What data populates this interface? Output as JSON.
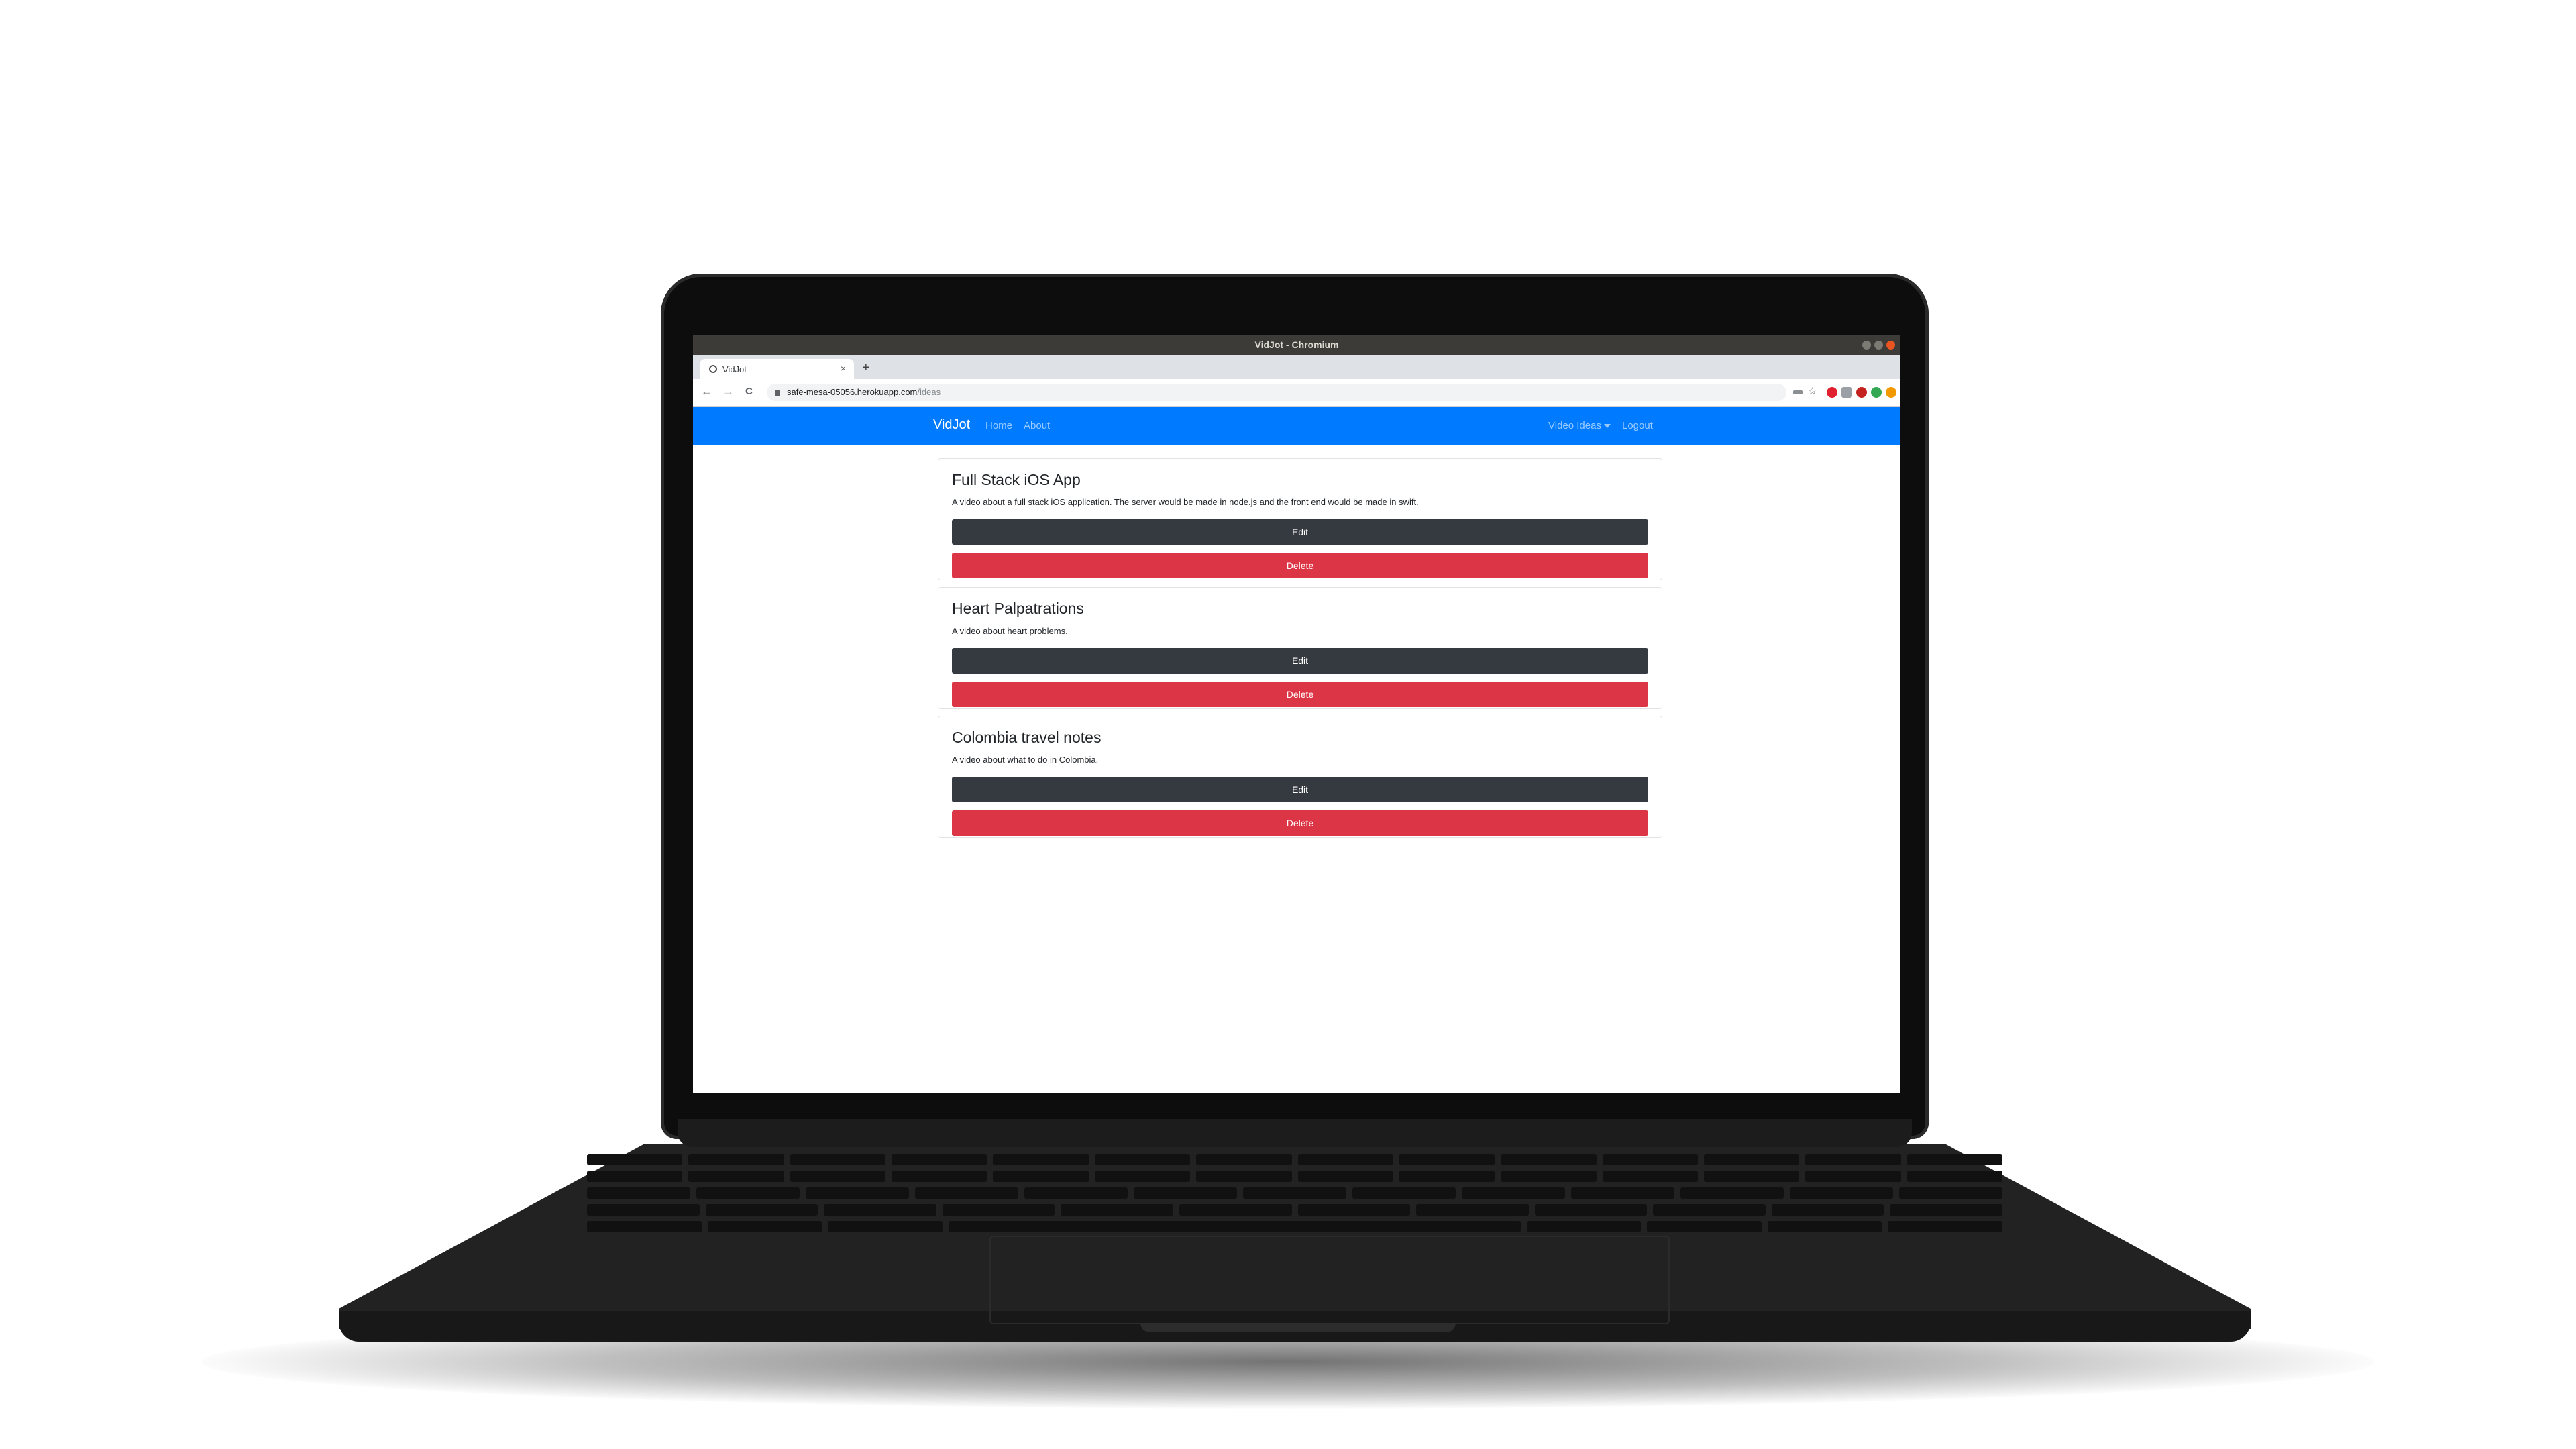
{
  "window": {
    "title": "VidJot - Chromium"
  },
  "browser": {
    "tab_title": "VidJot",
    "tab_close": "×",
    "new_tab": "+",
    "url_host": "safe-mesa-05056.herokuapp.com",
    "url_path": "/ideas",
    "back": "←",
    "forward": "→",
    "reload": "C"
  },
  "navbar": {
    "brand": "VidJot",
    "links": [
      "Home",
      "About"
    ],
    "right": [
      "Video Ideas",
      "Logout"
    ],
    "color": "#007bff"
  },
  "ideas": [
    {
      "title": "Full Stack iOS App",
      "details": "A video about a full stack iOS application. The server would be made in node.js and the front end would be made in swift.",
      "edit_label": "Edit",
      "delete_label": "Delete"
    },
    {
      "title": "Heart Palpatrations",
      "details": "A video about heart problems.",
      "edit_label": "Edit",
      "delete_label": "Delete"
    },
    {
      "title": "Colombia travel notes",
      "details": "A video about what to do in Colombia.",
      "edit_label": "Edit",
      "delete_label": "Delete"
    }
  ],
  "colors": {
    "edit_button": "#343a40",
    "delete_button": "#dc3545"
  }
}
